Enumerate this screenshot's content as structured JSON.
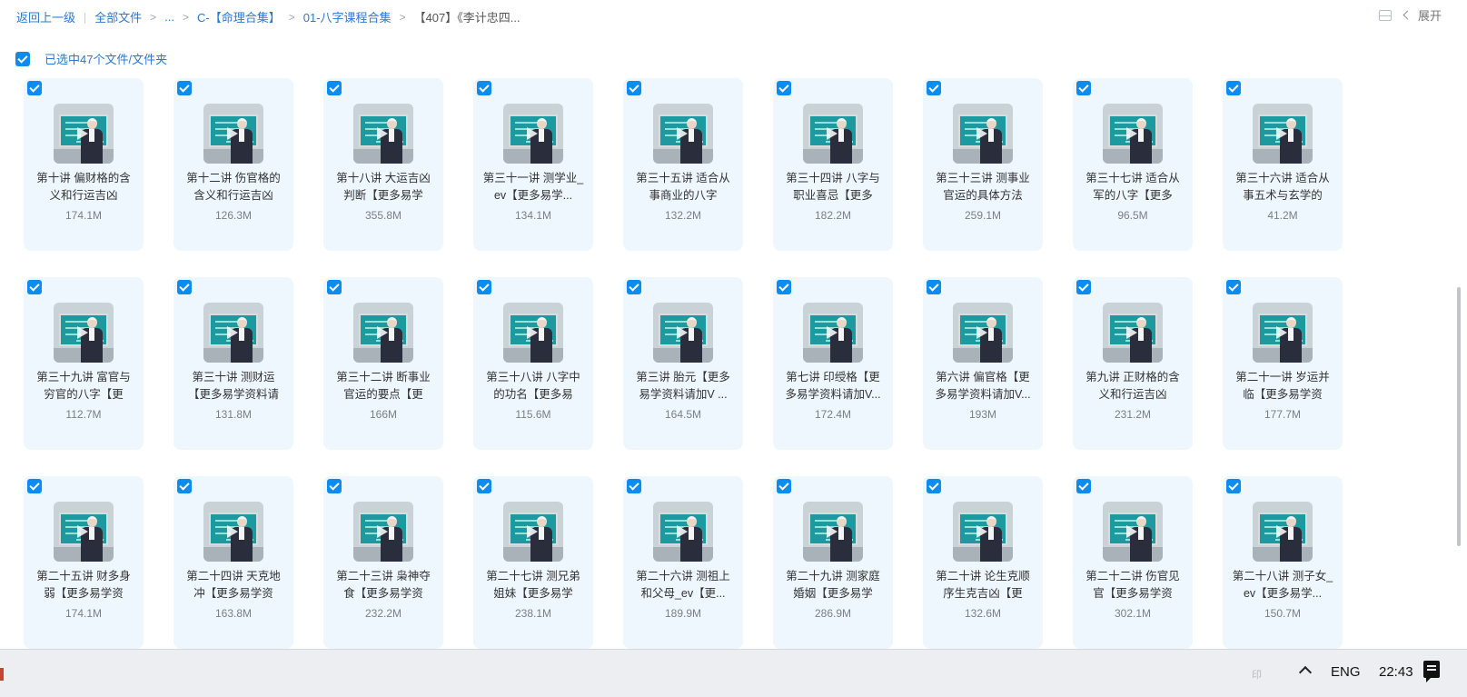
{
  "breadcrumb": {
    "back": "返回上一级",
    "items": [
      "全部文件",
      "...",
      "C-【命理合集】",
      "01-八字课程合集",
      "【407】《李计忠四..."
    ]
  },
  "top_right": {
    "expand_label": "展开"
  },
  "selection": {
    "text": "已选中47个文件/文件夹"
  },
  "files": [
    {
      "title": "第十讲 偏财格的含义和行运吉凶",
      "size": "174.1M"
    },
    {
      "title": "第十二讲 伤官格的含义和行运吉凶",
      "size": "126.3M"
    },
    {
      "title": "第十八讲 大运吉凶判断【更多易学",
      "size": "355.8M"
    },
    {
      "title": "第三十一讲 测学业_ev【更多易学...",
      "size": "134.1M"
    },
    {
      "title": "第三十五讲 适合从事商业的八字",
      "size": "132.2M"
    },
    {
      "title": "第三十四讲 八字与职业喜忌【更多",
      "size": "182.2M"
    },
    {
      "title": "第三十三讲 测事业官运的具体方法",
      "size": "259.1M"
    },
    {
      "title": "第三十七讲 适合从军的八字【更多",
      "size": "96.5M"
    },
    {
      "title": "第三十六讲 适合从事五术与玄学的",
      "size": "41.2M"
    },
    {
      "title": "第三十九讲 富官与穷官的八字【更",
      "size": "112.7M"
    },
    {
      "title": "第三十讲 测财运【更多易学资料请",
      "size": "131.8M"
    },
    {
      "title": "第三十二讲 断事业官运的要点【更",
      "size": "166M"
    },
    {
      "title": "第三十八讲 八字中的功名【更多易",
      "size": "115.6M"
    },
    {
      "title": "第三讲 胎元【更多易学资料请加V ...",
      "size": "164.5M"
    },
    {
      "title": "第七讲 印绶格【更多易学资料请加V...",
      "size": "172.4M"
    },
    {
      "title": "第六讲 偏官格【更多易学资料请加V...",
      "size": "193M"
    },
    {
      "title": "第九讲 正财格的含义和行运吉凶",
      "size": "231.2M"
    },
    {
      "title": "第二十一讲 岁运并临【更多易学资",
      "size": "177.7M"
    },
    {
      "title": "第二十五讲 财多身弱【更多易学资",
      "size": "174.1M"
    },
    {
      "title": "第二十四讲 天克地冲【更多易学资",
      "size": "163.8M"
    },
    {
      "title": "第二十三讲 枭神夺食【更多易学资",
      "size": "232.2M"
    },
    {
      "title": "第二十七讲 测兄弟姐妹【更多易学",
      "size": "238.1M"
    },
    {
      "title": "第二十六讲 测祖上和父母_ev【更...",
      "size": "189.9M"
    },
    {
      "title": "第二十九讲 测家庭婚姻【更多易学",
      "size": "286.9M"
    },
    {
      "title": "第二十讲 论生克顺序生克吉凶【更",
      "size": "132.6M"
    },
    {
      "title": "第二十二讲 伤官见官【更多易学资",
      "size": "302.1M"
    },
    {
      "title": "第二十八讲 测子女_ev【更多易学...",
      "size": "150.7M"
    }
  ],
  "taskbar": {
    "faint": "印",
    "lang": "ENG",
    "time": "22:43"
  }
}
